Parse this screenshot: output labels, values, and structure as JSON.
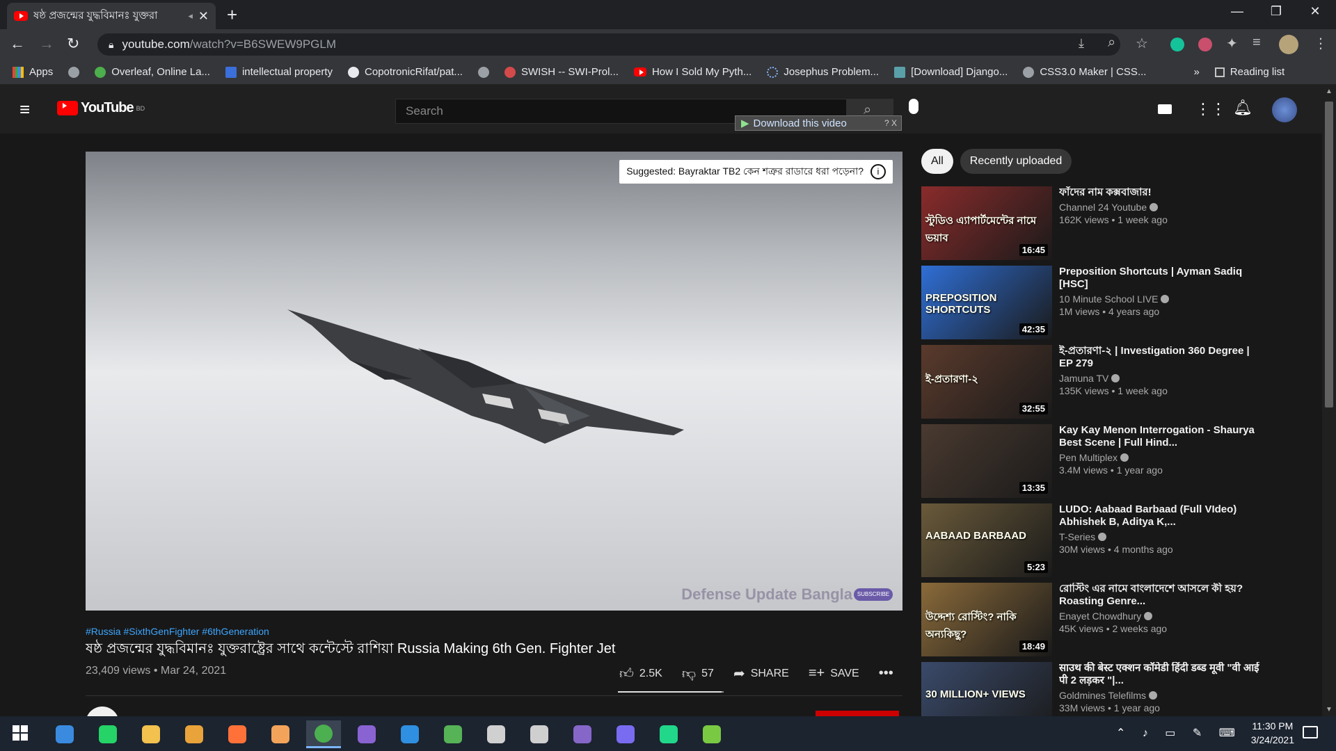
{
  "browser": {
    "tab_title": "ষষ্ঠ প্রজন্মের যুদ্ধবিমানঃ যুক্তরা",
    "url_host": "youtube.com",
    "url_path": "/watch?v=B6SWEW9PGLM",
    "bookmarks": [
      {
        "label": "Apps",
        "icon": "apps-grid-icon"
      },
      {
        "label": "",
        "icon": "globe-icon"
      },
      {
        "label": "Overleaf, Online La...",
        "icon": "overleaf-icon"
      },
      {
        "label": "intellectual property",
        "icon": "bookmark-s-icon"
      },
      {
        "label": "CopotronicRifat/pat...",
        "icon": "github-icon"
      },
      {
        "label": "",
        "icon": "globe-icon"
      },
      {
        "label": "SWISH -- SWI-Prol...",
        "icon": "swish-icon"
      },
      {
        "label": "How I Sold My Pyth...",
        "icon": "youtube-icon"
      },
      {
        "label": "Josephus Problem...",
        "icon": "loading-icon"
      },
      {
        "label": "[Download] Django...",
        "icon": "page-icon"
      },
      {
        "label": "CSS3.0 Maker | CSS...",
        "icon": "globe-icon"
      }
    ],
    "overflow_label": "»",
    "reading_list": "Reading list"
  },
  "youtube": {
    "logo_text": "YouTube",
    "logo_region": "BD",
    "search_placeholder": "Search",
    "download_helper": "Download this video",
    "download_helper_icons": "? X"
  },
  "video": {
    "suggested_card": "Suggested: Bayraktar TB2 কেন শত্রুর রাডারে ধরা পড়েনা?",
    "watermark": "Defense Update Bangla",
    "subscribe_badge": "SUBSCRIBE",
    "hashtags": "#Russia #SixthGenFighter #6thGeneration",
    "title": "ষষ্ঠ প্রজন্মের যুদ্ধবিমানঃ যুক্তরাষ্ট্রের সাথে কন্টেস্টে রাশিয়া Russia Making 6th Gen. Fighter Jet",
    "views_date": "23,409 views • Mar 24, 2021",
    "likes": "2.5K",
    "dislikes": "57",
    "share": "SHARE",
    "save": "SAVE",
    "like_ratio": 0.98
  },
  "sidebar": {
    "chips": [
      "All",
      "Recently uploaded"
    ],
    "items": [
      {
        "title": "ফাঁদের নাম কক্সবাজার!",
        "channel": "Channel 24 Youtube",
        "meta": "162K views • 1 week ago",
        "duration": "16:45",
        "thumb_color": "#8a2b2b",
        "thumb_caption": "স্টুডিও এ্যাপার্টমেন্টের নামে ভয়াব"
      },
      {
        "title": "Preposition Shortcuts | Ayman Sadiq [HSC]",
        "channel": "10 Minute School LIVE",
        "meta": "1M views • 4 years ago",
        "duration": "42:35",
        "thumb_color": "#2f6fd6",
        "thumb_caption": "PREPOSITION SHORTCUTS"
      },
      {
        "title": "ই-প্রতারণা-২ | Investigation 360 Degree | EP 279",
        "channel": "Jamuna TV",
        "meta": "135K views • 1 week ago",
        "duration": "32:55",
        "thumb_color": "#5a3a2c",
        "thumb_caption": "ই-প্রতারণা-২"
      },
      {
        "title": "Kay Kay Menon Interrogation - Shaurya Best Scene | Full Hind...",
        "channel": "Pen Multiplex",
        "meta": "3.4M views • 1 year ago",
        "duration": "13:35",
        "thumb_color": "#4a3a30",
        "thumb_caption": ""
      },
      {
        "title": "LUDO: Aabaad Barbaad (Full VIdeo) Abhishek B, Aditya K,...",
        "channel": "T-Series",
        "meta": "30M views • 4 months ago",
        "duration": "5:23",
        "thumb_color": "#6a5a3a",
        "thumb_caption": "AABAAD BARBAAD"
      },
      {
        "title": "রোস্টিং এর নামে বাংলাদেশে আসলে কী হয়? Roasting Genre...",
        "channel": "Enayet Chowdhury",
        "meta": "45K views • 2 weeks ago",
        "duration": "18:49",
        "thumb_color": "#8a6a3a",
        "thumb_caption": "উদ্দেশ্য রোস্টিং? নাকি অন্যকিছু?"
      },
      {
        "title": "साउथ की बेस्ट एक्शन कॉमेडी हिंदी डब्ड मूवी \"वी आई पी 2 लड़कर \"|...",
        "channel": "Goldmines Telefilms",
        "meta": "33M views • 1 year ago",
        "duration": "",
        "thumb_color": "#3a4a6a",
        "thumb_caption": "30 MILLION+ VIEWS"
      }
    ]
  },
  "taskbar": {
    "time": "11:30 PM",
    "date": "3/24/2021",
    "apps": [
      {
        "name": "windows-start-icon",
        "color": "#ffffff"
      },
      {
        "name": "search-app-icon",
        "color": "#3a8be0"
      },
      {
        "name": "whatsapp-icon",
        "color": "#25d366"
      },
      {
        "name": "file-explorer-icon",
        "color": "#f2c14e"
      },
      {
        "name": "shield-app-icon",
        "color": "#e8a33a"
      },
      {
        "name": "firefox-icon",
        "color": "#ff7139"
      },
      {
        "name": "app-orange-icon",
        "color": "#f3a45a"
      },
      {
        "name": "chrome-icon",
        "color": "#4caf50"
      },
      {
        "name": "github-desktop-icon",
        "color": "#8a63d2"
      },
      {
        "name": "vscode-icon",
        "color": "#2f8fe0"
      },
      {
        "name": "app-globe-icon",
        "color": "#56b356"
      },
      {
        "name": "parachute-icon",
        "color": "#d0d0d0"
      },
      {
        "name": "satellite-icon",
        "color": "#cfcfcf"
      },
      {
        "name": "visual-studio-icon",
        "color": "#8667c9"
      },
      {
        "name": "messenger-icon",
        "color": "#7a6cf0"
      },
      {
        "name": "pycharm-icon",
        "color": "#21d789"
      },
      {
        "name": "notepad-icon",
        "color": "#7ac943"
      }
    ]
  }
}
